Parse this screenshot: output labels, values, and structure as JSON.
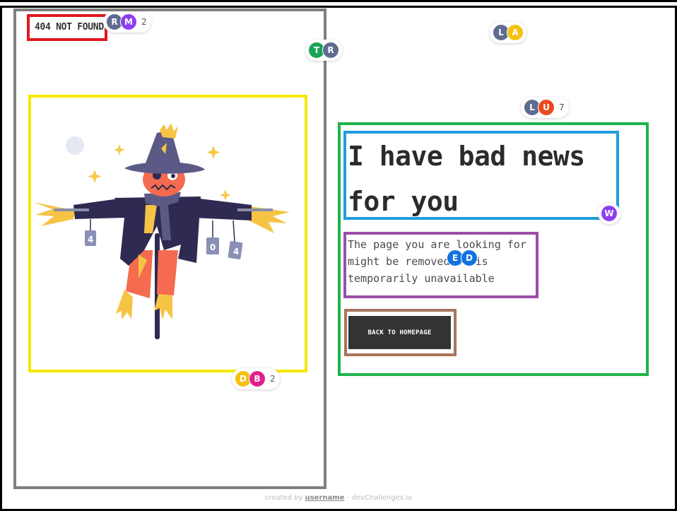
{
  "brand": {
    "logo_text": "404 NOT FOUND"
  },
  "main": {
    "headline": "I have bad news for you",
    "description": "The page you are looking for might be removed or is temporarily unavailable",
    "button_label": "BACK TO HOMEPAGE"
  },
  "illustration": {
    "name": "scarecrow-illustration",
    "can_labels": [
      "4",
      "0",
      "4"
    ]
  },
  "footer": {
    "prefix": "created by",
    "username": "username",
    "suffix": "- devChallenges.io"
  },
  "presence": [
    {
      "avatars": [
        {
          "initial": "R",
          "color": "#5f6b8f"
        },
        {
          "initial": "M",
          "color": "#8b3ff0"
        }
      ],
      "count": "2"
    },
    {
      "avatars": [
        {
          "initial": "T",
          "color": "#1aa454"
        },
        {
          "initial": "R",
          "color": "#5f6b8f"
        }
      ],
      "count": ""
    },
    {
      "avatars": [
        {
          "initial": "L",
          "color": "#5f6b8f"
        },
        {
          "initial": "A",
          "color": "#f4c10f"
        }
      ],
      "count": ""
    },
    {
      "avatars": [
        {
          "initial": "L",
          "color": "#5f6b8f"
        },
        {
          "initial": "U",
          "color": "#ea4a1f"
        }
      ],
      "count": "7"
    },
    {
      "avatars": [
        {
          "initial": "W",
          "color": "#8b3ff0"
        }
      ],
      "count": ""
    },
    {
      "avatars": [
        {
          "initial": "E",
          "color": "#1273e0"
        },
        {
          "initial": "D",
          "color": "#1273e0"
        }
      ],
      "count": ""
    },
    {
      "avatars": [
        {
          "initial": "D",
          "color": "#f4c10f"
        },
        {
          "initial": "B",
          "color": "#e0208f"
        }
      ],
      "count": "2"
    }
  ],
  "colors": {
    "button_bg": "#333333",
    "gray_box": "#7f7f7f",
    "red_box": "#e0191f",
    "yellow_box": "#f6e800",
    "green_box": "#1fb34b",
    "blue_box": "#1e9ddf",
    "purple_box": "#9b4fa6",
    "brown_box": "#a8755b"
  }
}
